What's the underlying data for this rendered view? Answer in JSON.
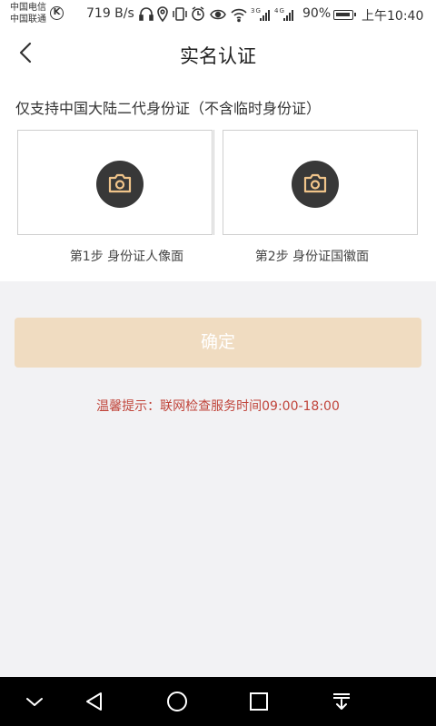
{
  "status_bar": {
    "carrier_1": "中国电信",
    "carrier_2": "中国联通",
    "k_badge": "K",
    "net_speed": "719 B/s",
    "icons": [
      "headset-icon",
      "location-icon",
      "vibrate-icon",
      "alarm-icon",
      "eye-icon",
      "wifi-icon",
      "signal-3g-icon",
      "signal-4g-icon"
    ],
    "battery_percent": "90%",
    "time": "上午10:40"
  },
  "header": {
    "title": "实名认证"
  },
  "upload": {
    "notice": "仅支持中国大陆二代身份证（不含临时身份证）",
    "step1_label": "第1步 身份证人像面",
    "step2_label": "第2步 身份证国徽面"
  },
  "actions": {
    "confirm_label": "确定"
  },
  "tip": "温馨提示：联网检查服务时间09:00-18:00",
  "colors": {
    "accent_disabled": "#f0dcc1",
    "camera_icon": "#f0c48a",
    "tip_text": "#c0443a"
  }
}
